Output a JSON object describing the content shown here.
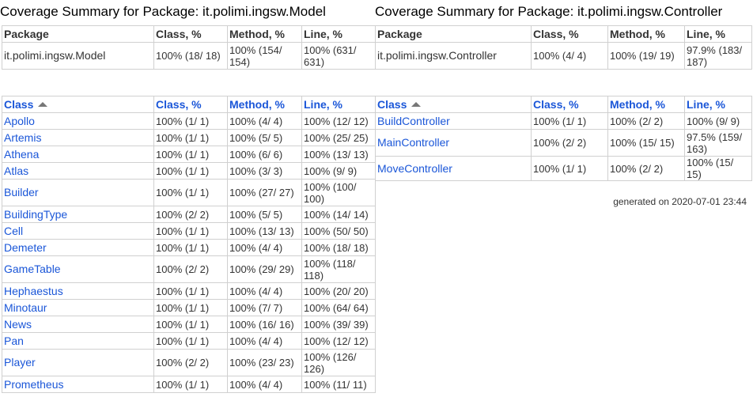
{
  "headers": {
    "package": "Package",
    "class": "Class",
    "class_pct": "Class, %",
    "method_pct": "Method, %",
    "line_pct": "Line, %"
  },
  "colors": {
    "link": "#1a56d8",
    "border": "#d0d0d0"
  },
  "left": {
    "title": "Coverage Summary for Package: it.polimi.ingsw.Model",
    "package": {
      "name": "it.polimi.ingsw.Model",
      "class": "100% (18/ 18)",
      "method": "100% (154/ 154)",
      "line": "100% (631/ 631)"
    },
    "classes": [
      {
        "name": "Apollo",
        "class": "100% (1/ 1)",
        "method": "100% (4/ 4)",
        "line": "100% (12/ 12)"
      },
      {
        "name": "Artemis",
        "class": "100% (1/ 1)",
        "method": "100% (5/ 5)",
        "line": "100% (25/ 25)"
      },
      {
        "name": "Athena",
        "class": "100% (1/ 1)",
        "method": "100% (6/ 6)",
        "line": "100% (13/ 13)"
      },
      {
        "name": "Atlas",
        "class": "100% (1/ 1)",
        "method": "100% (3/ 3)",
        "line": "100% (9/ 9)"
      },
      {
        "name": "Builder",
        "class": "100% (1/ 1)",
        "method": "100% (27/ 27)",
        "line": "100% (100/ 100)"
      },
      {
        "name": "BuildingType",
        "class": "100% (2/ 2)",
        "method": "100% (5/ 5)",
        "line": "100% (14/ 14)"
      },
      {
        "name": "Cell",
        "class": "100% (1/ 1)",
        "method": "100% (13/ 13)",
        "line": "100% (50/ 50)"
      },
      {
        "name": "Demeter",
        "class": "100% (1/ 1)",
        "method": "100% (4/ 4)",
        "line": "100% (18/ 18)"
      },
      {
        "name": "GameTable",
        "class": "100% (2/ 2)",
        "method": "100% (29/ 29)",
        "line": "100% (118/ 118)"
      },
      {
        "name": "Hephaestus",
        "class": "100% (1/ 1)",
        "method": "100% (4/ 4)",
        "line": "100% (20/ 20)"
      },
      {
        "name": "Minotaur",
        "class": "100% (1/ 1)",
        "method": "100% (7/ 7)",
        "line": "100% (64/ 64)"
      },
      {
        "name": "News",
        "class": "100% (1/ 1)",
        "method": "100% (16/ 16)",
        "line": "100% (39/ 39)"
      },
      {
        "name": "Pan",
        "class": "100% (1/ 1)",
        "method": "100% (4/ 4)",
        "line": "100% (12/ 12)"
      },
      {
        "name": "Player",
        "class": "100% (2/ 2)",
        "method": "100% (23/ 23)",
        "line": "100% (126/ 126)"
      },
      {
        "name": "Prometheus",
        "class": "100% (1/ 1)",
        "method": "100% (4/ 4)",
        "line": "100% (11/ 11)"
      }
    ]
  },
  "right": {
    "title": "Coverage Summary for Package: it.polimi.ingsw.Controller",
    "package": {
      "name": "it.polimi.ingsw.Controller",
      "class": "100% (4/ 4)",
      "method": "100% (19/ 19)",
      "line": "97.9% (183/ 187)"
    },
    "classes": [
      {
        "name": "BuildController",
        "class": "100% (1/ 1)",
        "method": "100% (2/ 2)",
        "line": "100% (9/ 9)"
      },
      {
        "name": "MainController",
        "class": "100% (2/ 2)",
        "method": "100% (15/ 15)",
        "line": "97.5% (159/ 163)"
      },
      {
        "name": "MoveController",
        "class": "100% (1/ 1)",
        "method": "100% (2/ 2)",
        "line": "100% (15/ 15)"
      }
    ],
    "generated": "generated on 2020-07-01 23:44"
  }
}
